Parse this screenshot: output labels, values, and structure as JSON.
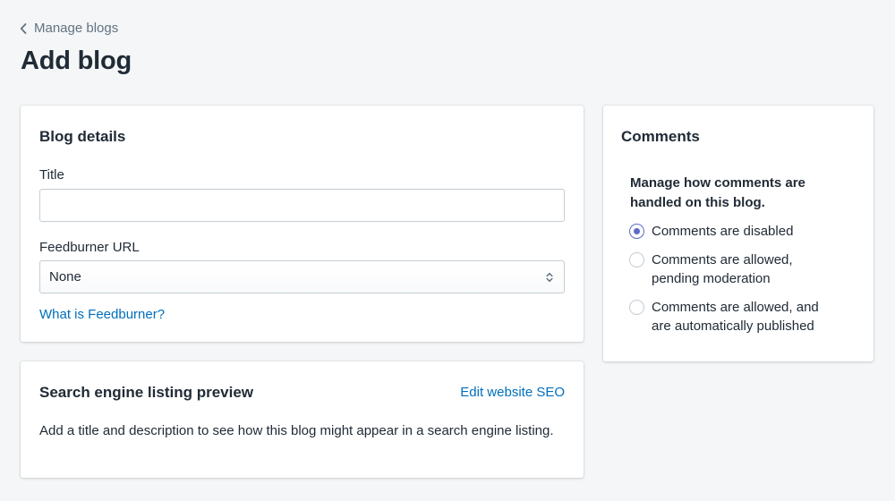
{
  "breadcrumb": {
    "label": "Manage blogs"
  },
  "page": {
    "title": "Add blog"
  },
  "blog_details": {
    "heading": "Blog details",
    "title_label": "Title",
    "title_value": "",
    "feedburner_label": "Feedburner URL",
    "feedburner_selected": "None",
    "feedburner_help_link": "What is Feedburner?"
  },
  "seo": {
    "heading": "Search engine listing preview",
    "edit_link": "Edit website SEO",
    "description": "Add a title and description to see how this blog might appear in a search engine listing."
  },
  "comments": {
    "heading": "Comments",
    "intro": "Manage how comments are handled on this blog.",
    "options": [
      {
        "label": "Comments are disabled",
        "checked": true
      },
      {
        "label": "Comments are allowed, pending moderation",
        "checked": false
      },
      {
        "label": "Comments are allowed, and are automatically published",
        "checked": false
      }
    ]
  },
  "colors": {
    "background": "#f4f6f8",
    "link": "#006fbb",
    "radio_accent": "#5c6ac4",
    "text": "#212b36",
    "muted": "#637381"
  },
  "icons": {
    "breadcrumb": "chevron-left-icon",
    "select": "select-arrows-icon"
  }
}
